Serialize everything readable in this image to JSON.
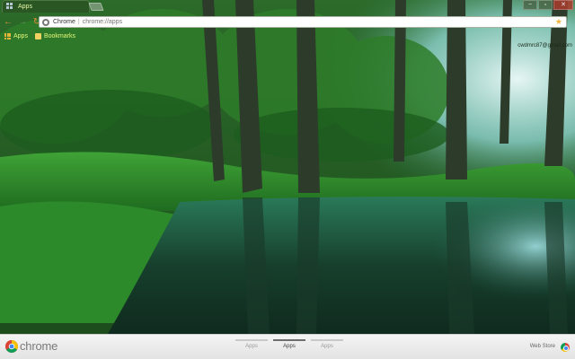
{
  "window": {
    "tab_title": "Apps",
    "new_tab_icon": "new-tab-icon",
    "controls": {
      "minimize": "−",
      "maximize": "▫",
      "close": "✕"
    }
  },
  "toolbar": {
    "back_icon": "←",
    "forward_icon": "→",
    "reload_icon": "↻",
    "omnibox": {
      "label": "Chrome",
      "url": "chrome://apps"
    },
    "star_icon": "★"
  },
  "bookmarks": {
    "items": [
      {
        "label": "Apps",
        "icon": "apps-grid-icon"
      },
      {
        "label": "Bookmarks",
        "icon": "folder-icon"
      }
    ]
  },
  "user": {
    "label": "cwdmrc87@gmail.com"
  },
  "launcher": {
    "brand": "chrome",
    "pages": [
      {
        "label": "Apps",
        "active": false
      },
      {
        "label": "Apps",
        "active": true
      },
      {
        "label": "Apps",
        "active": false
      }
    ],
    "webstore_label": "Web Store"
  },
  "colors": {
    "accent_orange": "#e98b3c",
    "bookmark_text": "#e6f77a",
    "launcher_bg": "#efefef"
  }
}
